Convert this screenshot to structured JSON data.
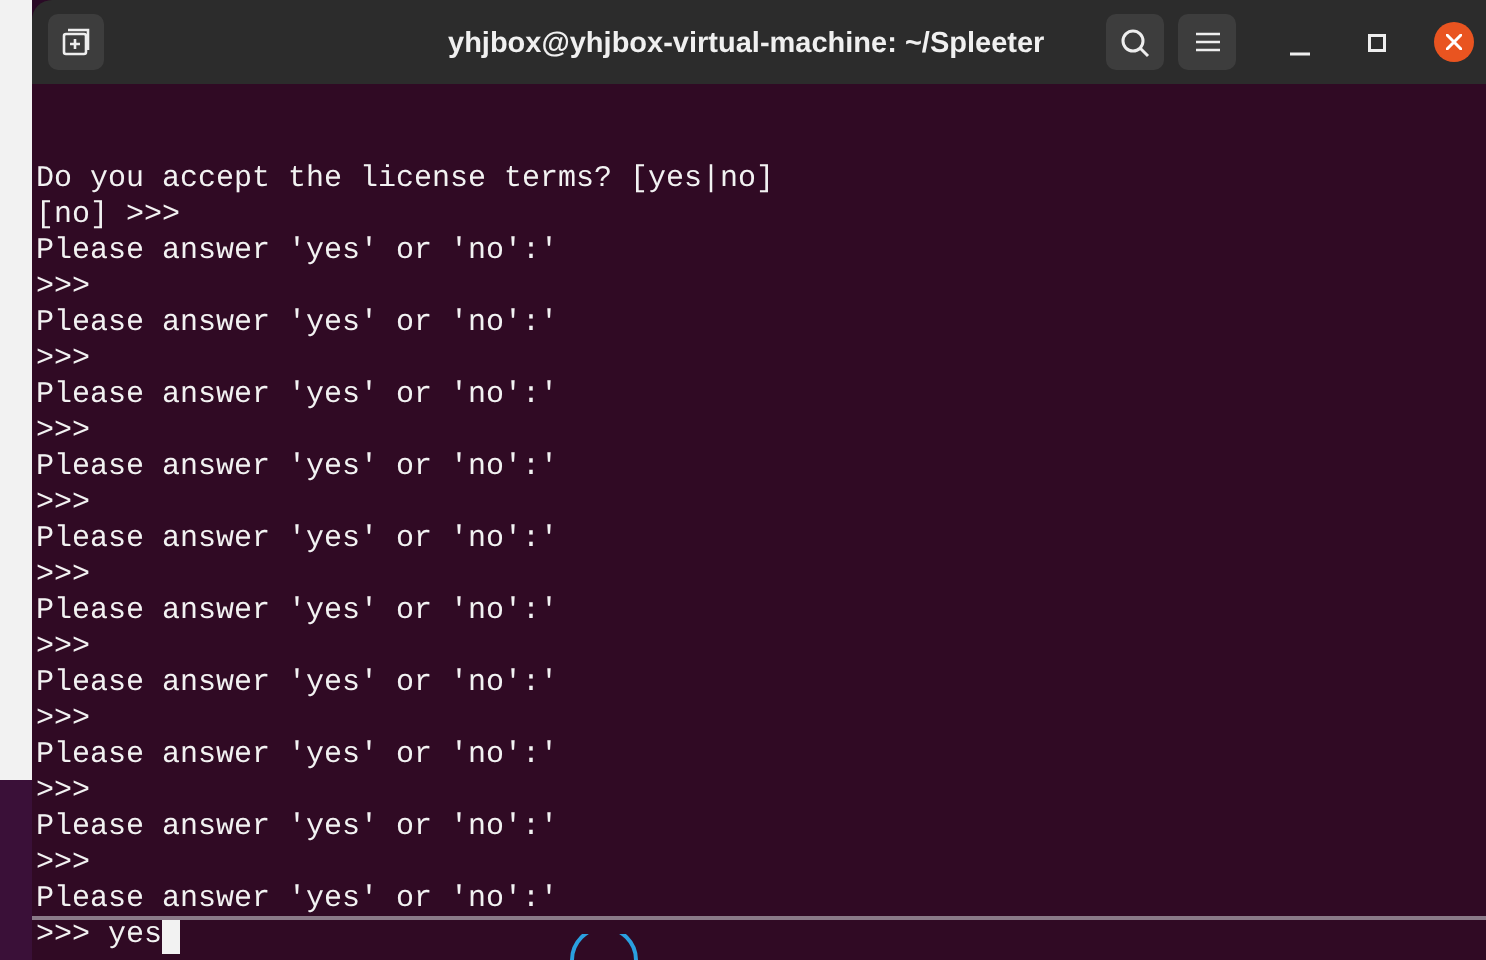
{
  "window": {
    "title": "yhjbox@yhjbox-virtual-machine: ~/Spleeter"
  },
  "terminal": {
    "lines": [
      "Do you accept the license terms? [yes|no]",
      "[no] >>>",
      "Please answer 'yes' or 'no':'",
      ">>>",
      "Please answer 'yes' or 'no':'",
      ">>>",
      "Please answer 'yes' or 'no':'",
      ">>>",
      "Please answer 'yes' or 'no':'",
      ">>>",
      "Please answer 'yes' or 'no':'",
      ">>>",
      "Please answer 'yes' or 'no':'",
      ">>>",
      "Please answer 'yes' or 'no':'",
      ">>>",
      "Please answer 'yes' or 'no':'",
      ">>>",
      "Please answer 'yes' or 'no':'",
      ">>>",
      "Please answer 'yes' or 'no':'"
    ],
    "prompt": ">>>",
    "input": "yes"
  }
}
